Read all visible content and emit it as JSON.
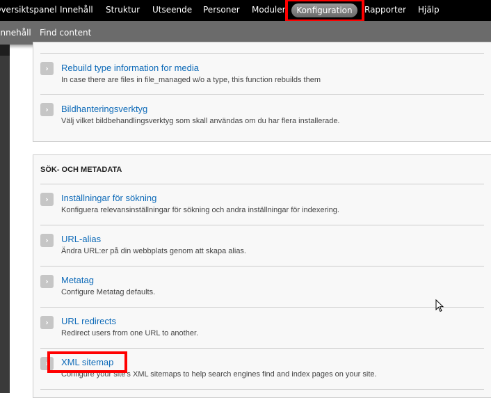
{
  "toolbar": {
    "items": [
      "Översiktspanel",
      "Innehåll",
      "Struktur",
      "Utseende",
      "Personer",
      "Moduler",
      "Konfiguration",
      "Rapporter",
      "Hjälp"
    ],
    "active": "Konfiguration"
  },
  "shortcuts": {
    "items": [
      "Innehåll",
      "Find content"
    ]
  },
  "panel1": {
    "items": [
      {
        "title": "Rebuild type information for media",
        "desc": "In case there are files in file_managed w/o a type, this function rebuilds them"
      },
      {
        "title": "Bildhanteringsverktyg",
        "desc": "Välj vilket bildbehandlingsverktyg som skall användas om du har flera installerade."
      }
    ]
  },
  "panel2": {
    "heading": "SÖK- OCH METADATA",
    "items": [
      {
        "title": "Inställningar för sökning",
        "desc": "Konfiguera relevansinställningar för sökning och andra inställningar för indexering."
      },
      {
        "title": "URL-alias",
        "desc": "Ändra URL:er på din webbplats genom att skapa alias."
      },
      {
        "title": "Metatag",
        "desc": "Configure Metatag defaults."
      },
      {
        "title": "URL redirects",
        "desc": "Redirect users from one URL to another."
      },
      {
        "title": "XML sitemap",
        "desc": "Configure your site's XML sitemaps to help search engines find and index pages on your site."
      }
    ]
  },
  "colors": {
    "link": "#0d6ab8",
    "highlight": "#ff0000"
  }
}
